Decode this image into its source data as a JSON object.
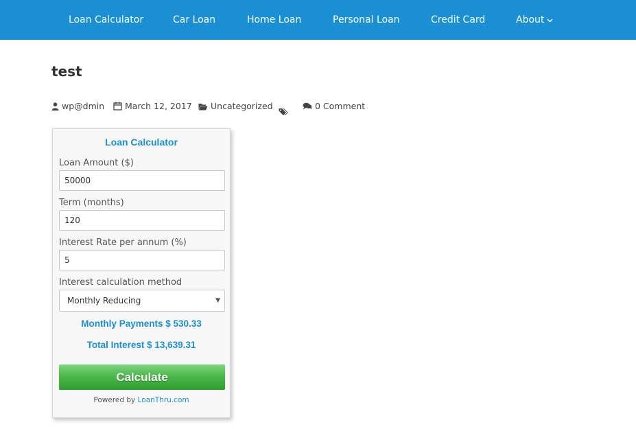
{
  "nav": {
    "items": [
      {
        "label": "Loan Calculator"
      },
      {
        "label": "Car Loan"
      },
      {
        "label": "Home Loan"
      },
      {
        "label": "Personal Loan"
      },
      {
        "label": "Credit Card"
      },
      {
        "label": "About"
      }
    ]
  },
  "post": {
    "title": "test",
    "author": "wp@dmin",
    "date": "March 12, 2017",
    "category": "Uncategorized",
    "comments": "0 Comment"
  },
  "calculator": {
    "title": "Loan Calculator",
    "amount_label": "Loan Amount ($)",
    "amount_value": "50000",
    "term_label": "Term (months)",
    "term_value": "120",
    "rate_label": "Interest Rate per annum (%)",
    "rate_value": "5",
    "method_label": "Interest calculation method",
    "method_value": "Monthly Reducing",
    "monthly_payments": "Monthly Payments $ 530.33",
    "total_interest": "Total Interest $ 13,639.31",
    "button_label": "Calculate",
    "powered_by": "Powered by",
    "powered_link": "LoanThru.com"
  },
  "colors": {
    "nav_bg": "#1a8fd3",
    "accent": "#1a8fd3",
    "button_green": "#4cb84c"
  },
  "icons": {
    "author": "user-icon",
    "date": "calendar-icon",
    "category": "folder-open-icon",
    "tags": "tags-icon",
    "comments": "comments-icon",
    "about_dropdown": "chevron-down-icon",
    "select_arrow": "caret-down-icon"
  }
}
